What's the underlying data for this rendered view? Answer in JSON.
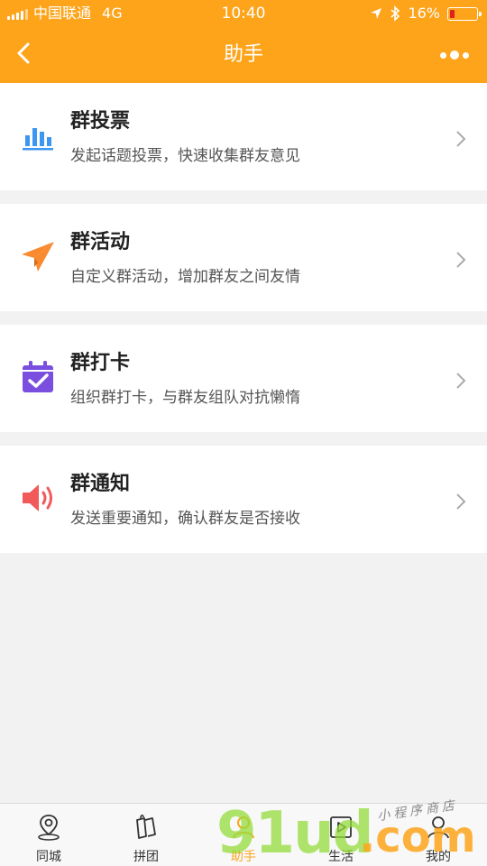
{
  "status_bar": {
    "carrier": "中国联通",
    "network": "4G",
    "time": "10:40",
    "battery": "16%"
  },
  "nav": {
    "title": "助手"
  },
  "items": [
    {
      "name": "群投票",
      "desc": "发起话题投票，快速收集群友意见",
      "icon": "bar-chart-icon",
      "color": "#3d97f2"
    },
    {
      "name": "群活动",
      "desc": "自定义群活动，增加群友之间友情",
      "icon": "paper-plane-icon",
      "color": "#f98a2f"
    },
    {
      "name": "群打卡",
      "desc": "组织群打卡，与群友组队对抗懒惰",
      "icon": "calendar-check-icon",
      "color": "#7a4fe0"
    },
    {
      "name": "群通知",
      "desc": "发送重要通知，确认群友是否接收",
      "icon": "speaker-icon",
      "color": "#f25a5a"
    }
  ],
  "tabs": [
    {
      "label": "同城",
      "icon": "location-icon"
    },
    {
      "label": "拼团",
      "icon": "tag-icon"
    },
    {
      "label": "助手",
      "icon": "helper-icon",
      "active": true
    },
    {
      "label": "生活",
      "icon": "life-icon"
    },
    {
      "label": "我的",
      "icon": "user-icon"
    }
  ],
  "watermark": {
    "brand": "91ud",
    "domain": ".com",
    "caption": "小程序商店"
  },
  "colors": {
    "accent": "#fda41b",
    "background": "#f2f2f2"
  }
}
